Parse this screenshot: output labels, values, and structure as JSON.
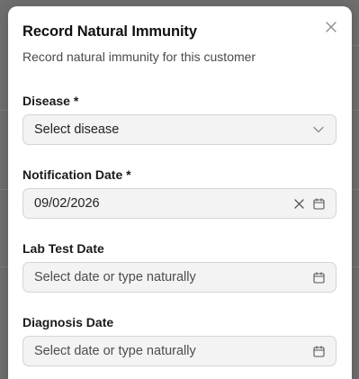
{
  "dialog": {
    "title": "Record Natural Immunity",
    "subtitle": "Record natural immunity for this customer"
  },
  "fields": {
    "disease": {
      "label": "Disease *",
      "placeholder": "Select disease"
    },
    "notification_date": {
      "label": "Notification Date *",
      "value": "09/02/2026"
    },
    "lab_test_date": {
      "label": "Lab Test Date",
      "placeholder": "Select date or type naturally"
    },
    "diagnosis_date": {
      "label": "Diagnosis Date",
      "placeholder": "Select date or type naturally"
    }
  },
  "icons": {
    "close": "close-icon",
    "chevron": "chevron-down-icon",
    "clear": "clear-icon",
    "calendar": "calendar-icon"
  },
  "colors": {
    "field_bg": "#f3f3f3",
    "field_border": "#d4d4d4",
    "backdrop": "#6e6e6e"
  }
}
